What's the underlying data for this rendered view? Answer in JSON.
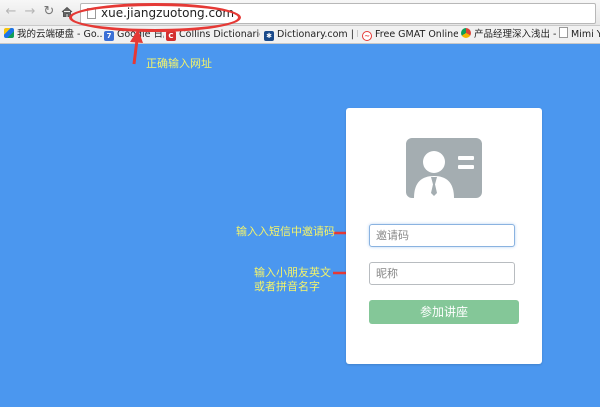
{
  "browser": {
    "url": "xue.jiangzuotong.com",
    "bookmarks": [
      {
        "label": "我的云端硬盘 - Go...",
        "icon": "google-drive-icon"
      },
      {
        "label": "Google 日历",
        "icon": "google-calendar-icon"
      },
      {
        "label": "Collins Dictionarie...",
        "icon": "collins-icon"
      },
      {
        "label": "Dictionary.com | Fi...",
        "icon": "dictionary-icon"
      },
      {
        "label": "Free GMAT Online...",
        "icon": "gmat-icon"
      },
      {
        "label": "产品经理深入浅出 -...",
        "icon": "chrome-icon"
      },
      {
        "label": "Mimi Yo",
        "icon": "document-icon"
      }
    ]
  },
  "annotations": {
    "url_note": "正确输入网址",
    "invite_note": "输入入短信中邀请码",
    "nickname_note_line1": "输入小朋友英文",
    "nickname_note_line2": "或者拼音名字"
  },
  "login": {
    "invite_placeholder": "邀请码",
    "nickname_placeholder": "昵称",
    "submit_label": "参加讲座"
  },
  "colors": {
    "background": "#4b97ef",
    "annotation_red": "#e53935",
    "annotation_text": "#f4f46a",
    "button": "#84c798",
    "avatar": "#a4adb1"
  }
}
